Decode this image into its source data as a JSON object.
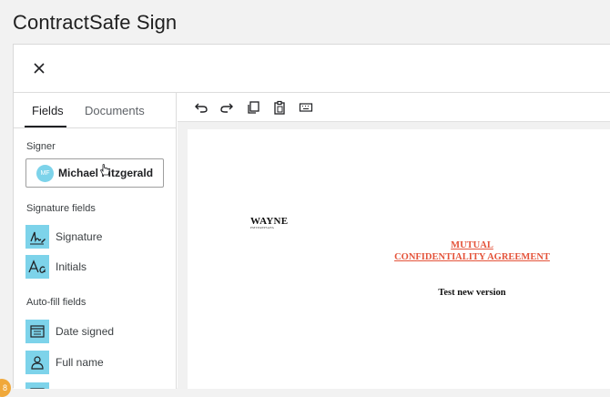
{
  "app": {
    "title": "ContractSafe Sign"
  },
  "sidebar": {
    "tabs": [
      {
        "label": "Fields",
        "active": true
      },
      {
        "label": "Documents",
        "active": false
      }
    ],
    "signer": {
      "section_label": "Signer",
      "initials": "MF",
      "name": "Michael Fitzgerald"
    },
    "signature_fields": {
      "section_label": "Signature fields",
      "items": [
        {
          "label": "Signature",
          "icon": "signature-icon"
        },
        {
          "label": "Initials",
          "icon": "initials-icon"
        }
      ]
    },
    "autofill_fields": {
      "section_label": "Auto-fill fields",
      "items": [
        {
          "label": "Date signed",
          "icon": "calendar-icon"
        },
        {
          "label": "Full name",
          "icon": "person-icon"
        }
      ]
    }
  },
  "toolbar": {
    "buttons": [
      "undo-icon",
      "redo-icon",
      "copy-icon",
      "paste-icon",
      "keyboard-icon"
    ]
  },
  "document": {
    "logo_text": "WAYNE",
    "logo_subtext": "PMTPAPPSAFA",
    "heading_line1": "MUTUAL",
    "heading_line2": "CONFIDENTIALITY AGREEMENT",
    "subtitle": "Test new version"
  },
  "colors": {
    "accent": "#7dd3ea",
    "heading_red": "#e4533a",
    "badge": "#f0a83a"
  },
  "badge": {
    "text": "8"
  }
}
